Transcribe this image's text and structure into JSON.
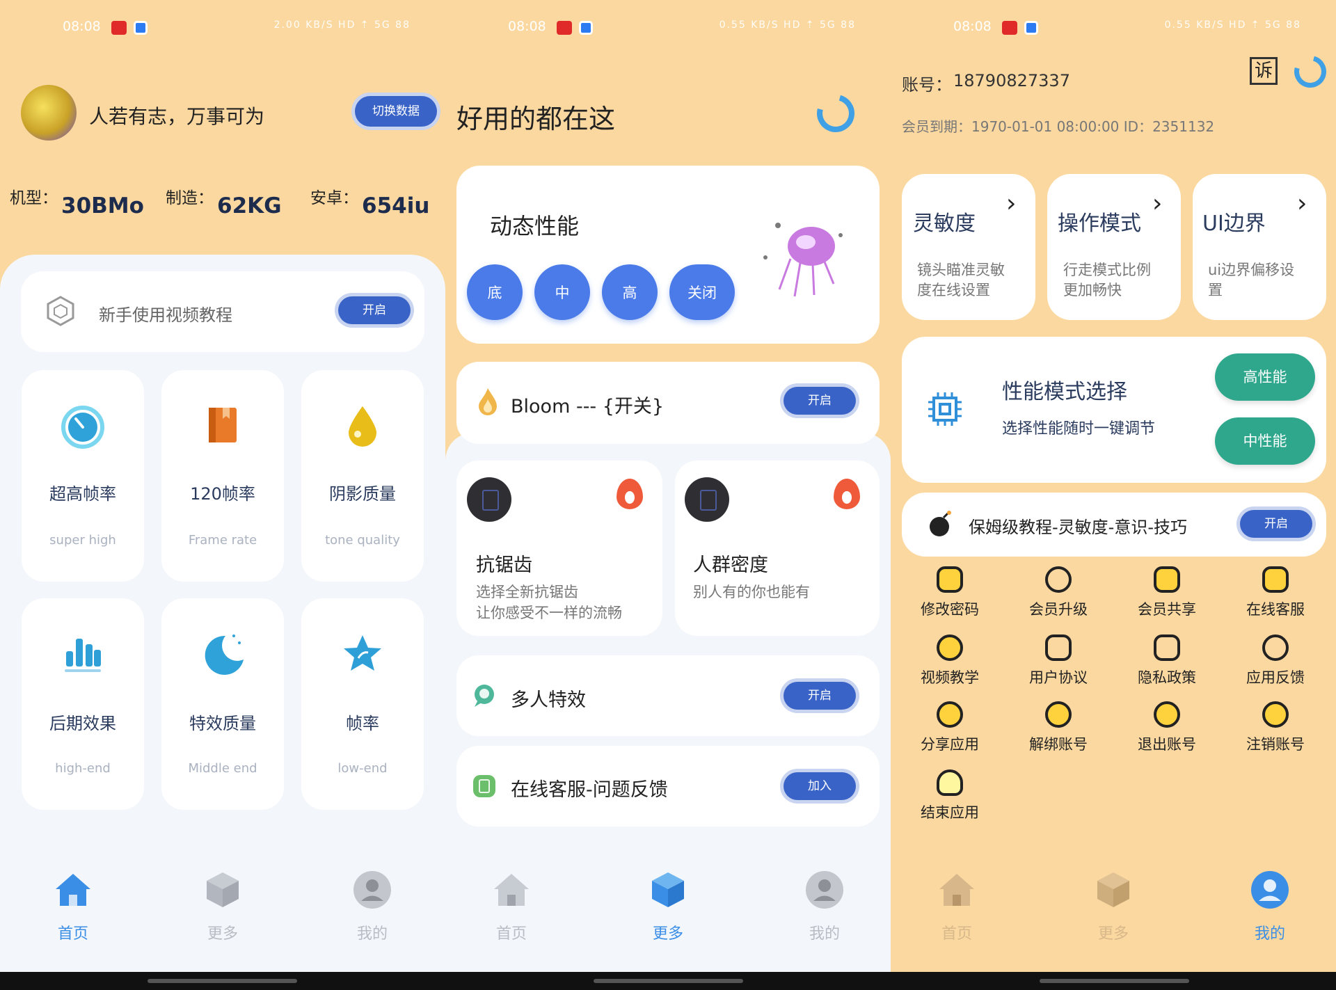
{
  "status_bar": {
    "time": "08:08",
    "right_p1": "2.00 KB/S HD ⇡ 5G 88",
    "right_p2": "0.55 KB/S HD ⇡ 5G 88",
    "right_p3": "0.55 KB/S HD ⇡ 5G 88"
  },
  "home": {
    "motto": "人若有志，万事可为",
    "switch_button": "切换数据",
    "specs": [
      {
        "label": "机型：",
        "value": "30BMo"
      },
      {
        "label": "制造：",
        "value": "62KG"
      },
      {
        "label": "安卓：",
        "value": "654iu"
      }
    ],
    "tutorial": {
      "label": "新手使用视频教程",
      "button": "开启"
    },
    "tiles": [
      {
        "title": "超高帧率",
        "sub": "super high",
        "icon": "gauge-icon"
      },
      {
        "title": "120帧率",
        "sub": "Frame rate",
        "icon": "book-icon"
      },
      {
        "title": "阴影质量",
        "sub": "tone quality",
        "icon": "drop-icon"
      },
      {
        "title": "后期效果",
        "sub": "high-end",
        "icon": "bar-chart-icon"
      },
      {
        "title": "特效质量",
        "sub": "Middle end",
        "icon": "moon-icon"
      },
      {
        "title": "帧率",
        "sub": "low-end",
        "icon": "star-icon"
      }
    ]
  },
  "more": {
    "title": "好用的都在这",
    "dynamic": {
      "title": "动态性能",
      "buttons": [
        "底",
        "中",
        "高",
        "关闭"
      ]
    },
    "bloom": {
      "label": "Bloom --- {开关}",
      "button": "开启"
    },
    "cards": [
      {
        "title": "抗锯齿",
        "sub1": "选择全新抗锯齿",
        "sub2": "让你感受不一样的流畅"
      },
      {
        "title": "人群密度",
        "sub1": "别人有的你也能有",
        "sub2": ""
      }
    ],
    "multi": {
      "label": "多人特效",
      "button": "开启"
    },
    "support": {
      "label": "在线客服-问题反馈",
      "button": "加入"
    }
  },
  "mine": {
    "account_label": "账号：",
    "account": "18790827337",
    "expiry_line": "会员到期：1970-01-01 08:00:00  ID：2351132",
    "complain_icon_text": "诉",
    "cards": [
      {
        "title": "灵敏度",
        "sub1": "镜头瞄准灵敏",
        "sub2": "度在线设置"
      },
      {
        "title": "操作模式",
        "sub1": "行走模式比例",
        "sub2": "更加畅快"
      },
      {
        "title": "UI边界",
        "sub1": "ui边界偏移设",
        "sub2": "置"
      }
    ],
    "perf": {
      "title": "性能模式选择",
      "sub": "选择性能随时一键调节",
      "high": "高性能",
      "mid": "中性能"
    },
    "guide": {
      "label": "保姆级教程-灵敏度-意识-技巧",
      "button": "开启"
    },
    "grid": [
      "修改密码",
      "会员升级",
      "会员共享",
      "在线客服",
      "视频教学",
      "用户协议",
      "隐私政策",
      "应用反馈",
      "分享应用",
      "解绑账号",
      "退出账号",
      "注销账号",
      "结束应用"
    ]
  },
  "nav": {
    "home": "首页",
    "more": "更多",
    "mine": "我的"
  },
  "colors": {
    "bg": "#fbd8a0",
    "accent_blue": "#3a63c7",
    "button_blue": "#4a7be8",
    "teal": "#2ea78c",
    "active_nav": "#3a8ee6",
    "inactive_nav": "#b8bcc4"
  }
}
